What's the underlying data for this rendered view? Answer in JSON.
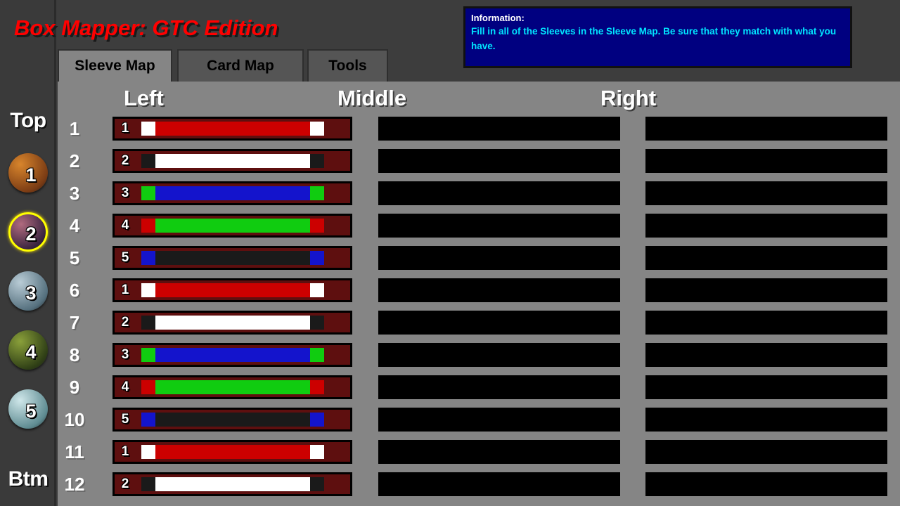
{
  "app": {
    "title": "Box Mapper: GTC Edition",
    "title_color": "#ff0000"
  },
  "info": {
    "label": "Information:",
    "text": "Fill in all of the Sleeves in the Sleeve Map. Be sure that they match with what you have.",
    "background": "#000080",
    "label_color": "#ffffff",
    "text_color": "#00e5ff"
  },
  "tabs": [
    {
      "label": "Sleeve Map",
      "active": true
    },
    {
      "label": "Card Map",
      "active": false
    },
    {
      "label": "Tools",
      "active": false
    }
  ],
  "rail": {
    "top_label": "Top",
    "bottom_label": "Btm",
    "avatars": [
      {
        "number": "1",
        "selected": false,
        "tint_a": "#d8852c",
        "tint_b": "#7a3b14"
      },
      {
        "number": "2",
        "selected": true,
        "tint_a": "#b06a7e",
        "tint_b": "#3a2440"
      },
      {
        "number": "3",
        "selected": false,
        "tint_a": "#b9ccd6",
        "tint_b": "#55707e"
      },
      {
        "number": "4",
        "selected": false,
        "tint_a": "#8aa03a",
        "tint_b": "#2f3f16"
      },
      {
        "number": "5",
        "selected": false,
        "tint_a": "#cfe7ea",
        "tint_b": "#5e8b91"
      }
    ]
  },
  "columns": [
    {
      "header": "Left"
    },
    {
      "header": "Middle"
    },
    {
      "header": "Right"
    }
  ],
  "palette": {
    "red": "#cc0000",
    "white": "#ffffff",
    "green": "#10cc10",
    "blue": "#1414cc",
    "black": "#1a1a1a",
    "sleeve_bg": "#5e0f0f",
    "panel_bg": "#858585",
    "empty_slot": "#000000"
  },
  "rows": [
    {
      "row": "1",
      "sleeve": "1",
      "cap": "#ffffff",
      "mid": "#cc0000",
      "mid_empty": true,
      "right_empty": true
    },
    {
      "row": "2",
      "sleeve": "2",
      "cap": "#1a1a1a",
      "mid": "#ffffff",
      "mid_empty": true,
      "right_empty": true
    },
    {
      "row": "3",
      "sleeve": "3",
      "cap": "#10cc10",
      "mid": "#1414cc",
      "mid_empty": true,
      "right_empty": true
    },
    {
      "row": "4",
      "sleeve": "4",
      "cap": "#cc0000",
      "mid": "#10cc10",
      "mid_empty": true,
      "right_empty": true
    },
    {
      "row": "5",
      "sleeve": "5",
      "cap": "#1414cc",
      "mid": "#1a1a1a",
      "mid_empty": true,
      "right_empty": true
    },
    {
      "row": "6",
      "sleeve": "1",
      "cap": "#ffffff",
      "mid": "#cc0000",
      "mid_empty": true,
      "right_empty": true
    },
    {
      "row": "7",
      "sleeve": "2",
      "cap": "#1a1a1a",
      "mid": "#ffffff",
      "mid_empty": true,
      "right_empty": true
    },
    {
      "row": "8",
      "sleeve": "3",
      "cap": "#10cc10",
      "mid": "#1414cc",
      "mid_empty": true,
      "right_empty": true
    },
    {
      "row": "9",
      "sleeve": "4",
      "cap": "#cc0000",
      "mid": "#10cc10",
      "mid_empty": true,
      "right_empty": true
    },
    {
      "row": "10",
      "sleeve": "5",
      "cap": "#1414cc",
      "mid": "#1a1a1a",
      "mid_empty": true,
      "right_empty": true
    },
    {
      "row": "11",
      "sleeve": "1",
      "cap": "#ffffff",
      "mid": "#cc0000",
      "mid_empty": true,
      "right_empty": true
    },
    {
      "row": "12",
      "sleeve": "2",
      "cap": "#1a1a1a",
      "mid": "#ffffff",
      "mid_empty": true,
      "right_empty": true
    }
  ]
}
